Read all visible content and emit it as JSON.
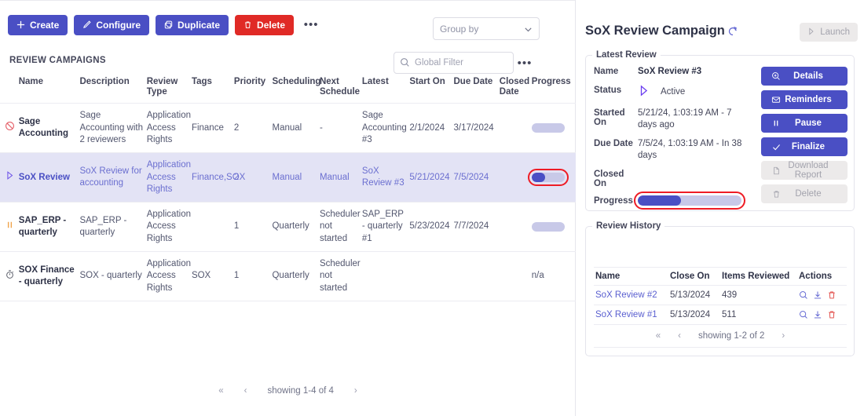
{
  "toolbar": {
    "create_label": "Create",
    "configure_label": "Configure",
    "duplicate_label": "Duplicate",
    "delete_label": "Delete",
    "more_label": "•••"
  },
  "section_title": "REVIEW CAMPAIGNS",
  "group_by": {
    "placeholder": "Group by"
  },
  "global_filter": {
    "placeholder": "Global Filter",
    "value": "",
    "more_label": "•••"
  },
  "table": {
    "columns": [
      "Name",
      "Description",
      "Review Type",
      "Tags",
      "Priority",
      "Scheduling",
      "Next Schedule",
      "Latest",
      "Start On",
      "Due Date",
      "Closed Date",
      "Progress"
    ],
    "rows": [
      {
        "status_icon": "blocked-icon",
        "name": "Sage Accounting",
        "description": "Sage Accounting with 2 reviewers",
        "review_type": "Application Access Rights",
        "tags": "Finance",
        "priority": "2",
        "scheduling": "Manual",
        "next_schedule": "-",
        "latest": "Sage Accounting #3",
        "start_on": "2/1/2024",
        "due_date": "3/17/2024",
        "closed_date": "",
        "progress": 0,
        "progress_text": ""
      },
      {
        "status_icon": "play-icon",
        "name": "SoX Review",
        "description": "SoX Review for accounting",
        "review_type": "Application Access Rights",
        "tags": "Finance,SOX",
        "priority": "2",
        "scheduling": "Manual",
        "next_schedule": "Manual",
        "latest": "SoX Review #3",
        "start_on": "5/21/2024",
        "due_date": "7/5/2024",
        "closed_date": "",
        "progress": 42,
        "progress_text": ""
      },
      {
        "status_icon": "pause-icon",
        "name": "SAP_ERP - quarterly",
        "description": "SAP_ERP - quarterly",
        "review_type": "Application Access Rights",
        "tags": "",
        "priority": "1",
        "scheduling": "Quarterly",
        "next_schedule": "Scheduler not started",
        "latest": "SAP_ERP - quarterly #1",
        "start_on": "5/23/2024",
        "due_date": "7/7/2024",
        "closed_date": "",
        "progress": 0,
        "progress_text": ""
      },
      {
        "status_icon": "timer-icon",
        "name": "SOX Finance - quarterly",
        "description": "SOX - quarterly",
        "review_type": "Application Access Rights",
        "tags": "SOX",
        "priority": "1",
        "scheduling": "Quarterly",
        "next_schedule": "Scheduler not started",
        "latest": "",
        "start_on": "",
        "due_date": "",
        "closed_date": "",
        "progress": null,
        "progress_text": "n/a"
      }
    ],
    "pager": {
      "first": "«",
      "prev": "‹",
      "label": "showing 1-4 of 4",
      "next": "›"
    }
  },
  "detail": {
    "title": "SoX Review Campaign",
    "launch_label": "Launch",
    "latest_review_legend": "Latest Review",
    "fields": {
      "name_label": "Name",
      "name_value": "SoX Review #3",
      "status_label": "Status",
      "status_value": "Active",
      "started_on_label": "Started On",
      "started_on_value": "5/21/24, 1:03:19 AM - 7 days ago",
      "due_date_label": "Due Date",
      "due_date_value": "7/5/24, 1:03:19 AM - In 38 days",
      "closed_on_label": "Closed On",
      "closed_on_value": "",
      "progress_label": "Progress",
      "progress_percent": 42
    },
    "actions": [
      {
        "label": "Details",
        "icon": "search-plus-icon",
        "disabled": false
      },
      {
        "label": "Reminders",
        "icon": "envelope-icon",
        "disabled": false
      },
      {
        "label": "Pause",
        "icon": "pause-icon",
        "disabled": false
      },
      {
        "label": "Finalize",
        "icon": "check-icon",
        "disabled": false
      },
      {
        "label": "Download Report",
        "icon": "file-icon",
        "disabled": true
      },
      {
        "label": "Delete",
        "icon": "trash-icon",
        "disabled": true
      }
    ],
    "history_legend": "Review History",
    "history": {
      "columns": [
        "Name",
        "Close On",
        "Items Reviewed",
        "Actions"
      ],
      "rows": [
        {
          "name": "SoX Review #2",
          "close_on": "5/13/2024",
          "items_reviewed": "439"
        },
        {
          "name": "SoX Review #1",
          "close_on": "5/13/2024",
          "items_reviewed": "511"
        }
      ],
      "pager": {
        "first": "«",
        "prev": "‹",
        "label": "showing 1-2 of 2",
        "next": "›"
      }
    }
  },
  "colors": {
    "accent": "#4a4fc4",
    "danger": "#e02a26",
    "highlight": "#ee1c25",
    "progress_track": "#c8c9e8"
  }
}
